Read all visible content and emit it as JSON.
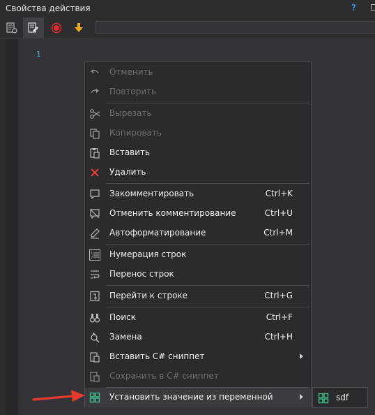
{
  "window": {
    "title": "Свойства действия",
    "help_label": "?"
  },
  "toolbar": {
    "buttons": [
      {
        "name": "properties-list-icon",
        "color": "#bdbdbd"
      },
      {
        "name": "edit-code-icon",
        "color": "#e0e0e0"
      },
      {
        "name": "record-icon",
        "color": "#e52b2b"
      },
      {
        "name": "download-arrow-icon",
        "color": "#f2a81d"
      }
    ]
  },
  "editor": {
    "line_numbers": [
      "1"
    ]
  },
  "context_menu": {
    "items": [
      {
        "label": "Отменить",
        "shortcut": "",
        "disabled": true,
        "icon": "undo-icon"
      },
      {
        "label": "Повторить",
        "shortcut": "",
        "disabled": true,
        "icon": "redo-icon"
      },
      {
        "label": "Вырезать",
        "shortcut": "",
        "disabled": true,
        "icon": "scissors-icon"
      },
      {
        "label": "Копировать",
        "shortcut": "",
        "disabled": true,
        "icon": "copy-icon"
      },
      {
        "label": "Вставить",
        "shortcut": "",
        "disabled": false,
        "icon": "paste-icon"
      },
      {
        "label": "Удалить",
        "shortcut": "",
        "disabled": false,
        "icon": "delete-icon"
      },
      {
        "label": "Закомментировать",
        "shortcut": "Ctrl+K",
        "disabled": false,
        "icon": "comment-icon"
      },
      {
        "label": "Отменить комментирование",
        "shortcut": "Ctrl+U",
        "disabled": false,
        "icon": "uncomment-icon"
      },
      {
        "label": "Автоформатирование",
        "shortcut": "Ctrl+M",
        "disabled": false,
        "icon": "pencil-icon"
      },
      {
        "label": "Нумерация строк",
        "shortcut": "",
        "disabled": false,
        "icon": "line-numbers-icon"
      },
      {
        "label": "Перенос строк",
        "shortcut": "",
        "disabled": false,
        "icon": "word-wrap-icon"
      },
      {
        "label": "Перейти к строке",
        "shortcut": "Ctrl+G",
        "disabled": false,
        "icon": "goto-line-icon"
      },
      {
        "label": "Поиск",
        "shortcut": "Ctrl+F",
        "disabled": false,
        "icon": "binoculars-icon"
      },
      {
        "label": "Замена",
        "shortcut": "Ctrl+H",
        "disabled": false,
        "icon": "replace-icon"
      },
      {
        "label": "Вставить C# сниппет",
        "shortcut": "",
        "disabled": false,
        "icon": "insert-snippet-icon",
        "submenu": true
      },
      {
        "label": "Сохранить в C# сниппет",
        "shortcut": "",
        "disabled": true,
        "icon": "save-snippet-icon"
      },
      {
        "label": "Установить значение из переменной",
        "shortcut": "",
        "disabled": false,
        "icon": "variable-grid-icon",
        "submenu": true,
        "highlighted": true
      }
    ]
  },
  "submenu": {
    "items": [
      {
        "label": "sdf",
        "icon": "variable-grid-icon"
      }
    ]
  },
  "colors": {
    "accent_green": "#3fc08a",
    "annotation_arrow": "#e23a2e",
    "delete_red": "#e0393e"
  }
}
